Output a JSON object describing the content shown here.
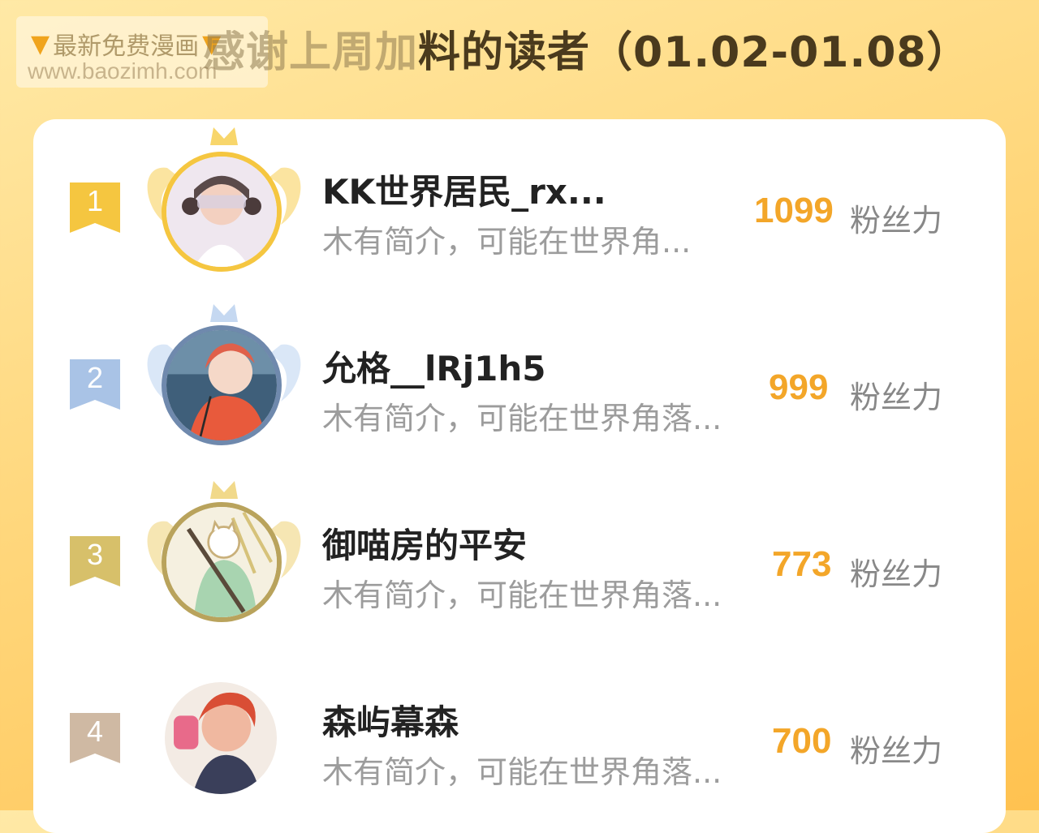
{
  "header": {
    "title_hidden": "感谢上周加",
    "title_visible": "料的读者（01.02-01.08）"
  },
  "watermark": {
    "line1": "最新免费漫画",
    "line2": "www.baozimh.com",
    "icon": "pointing-down-hand-icon"
  },
  "colors": {
    "accent": "#f3a629",
    "gold": "#f5c640",
    "silver": "#a9c3e6",
    "bronze": "#d7c06a",
    "fourth": "#cfb9a3"
  },
  "ranking": [
    {
      "rank": "1",
      "name": "KK世界居民_rx...",
      "bio": "木有简介，可能在世界角...",
      "score": "1099",
      "unit": "粉丝力"
    },
    {
      "rank": "2",
      "name": "允格__lRj1h5",
      "bio": "木有简介，可能在世界角落...",
      "score": "999",
      "unit": "粉丝力"
    },
    {
      "rank": "3",
      "name": "御喵房的平安",
      "bio": "木有简介，可能在世界角落...",
      "score": "773",
      "unit": "粉丝力"
    },
    {
      "rank": "4",
      "name": "森屿幕森",
      "bio": "木有简介，可能在世界角落...",
      "score": "700",
      "unit": "粉丝力"
    }
  ]
}
